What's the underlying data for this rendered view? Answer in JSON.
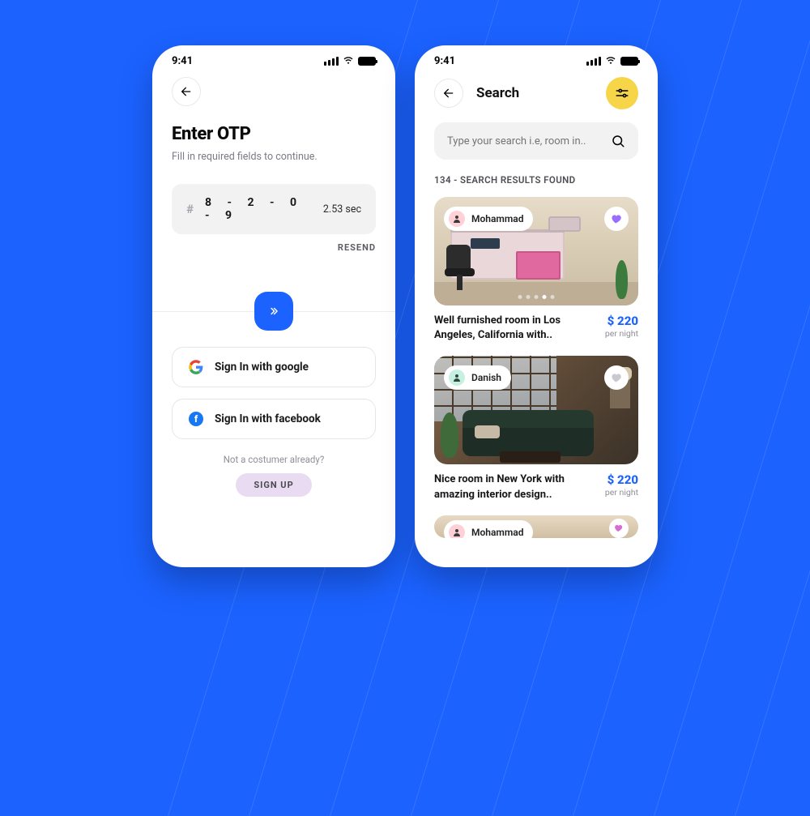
{
  "status": {
    "time": "9:41"
  },
  "otp": {
    "title": "Enter OTP",
    "subtitle": "Fill in required fields to continue.",
    "digits": "8 - 2 - 0 - 9",
    "timer": "2.53 sec",
    "resend": "RESEND",
    "google": "Sign In with google",
    "facebook": "Sign In with facebook",
    "note": "Not a costumer already?",
    "signup": "SIGN UP"
  },
  "search": {
    "title": "Search",
    "placeholder": "Type your search i.e, room in..",
    "results_heading": "134 - SEARCH RESULTS FOUND",
    "listings": [
      {
        "host": "Mohammad",
        "title": "Well furnished room in Los Angeles, California with..",
        "price": "$ 220",
        "unit": "per night",
        "fav": true
      },
      {
        "host": "Danish",
        "title": "Nice room in New York with amazing interior design..",
        "price": "$ 220",
        "unit": "per night",
        "fav": false
      },
      {
        "host": "Mohammad",
        "title": "",
        "price": "",
        "unit": "",
        "fav": true
      }
    ]
  }
}
